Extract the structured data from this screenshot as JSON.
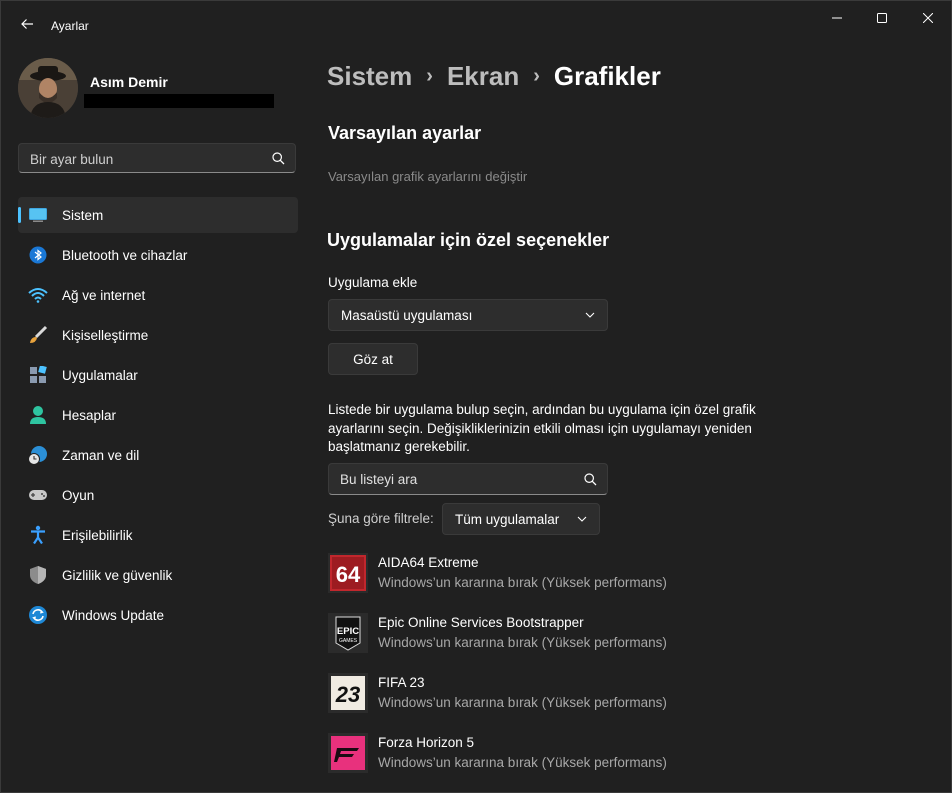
{
  "window": {
    "title": "Ayarlar"
  },
  "profile": {
    "name": "Asım Demir"
  },
  "search": {
    "placeholder": "Bir ayar bulun"
  },
  "nav": [
    {
      "label": "Sistem",
      "icon": "monitor-icon",
      "active": true
    },
    {
      "label": "Bluetooth ve cihazlar",
      "icon": "bluetooth-icon"
    },
    {
      "label": "Ağ ve internet",
      "icon": "wifi-icon"
    },
    {
      "label": "Kişiselleştirme",
      "icon": "brush-icon"
    },
    {
      "label": "Uygulamalar",
      "icon": "apps-icon"
    },
    {
      "label": "Hesaplar",
      "icon": "account-icon"
    },
    {
      "label": "Zaman ve dil",
      "icon": "globe-clock-icon"
    },
    {
      "label": "Oyun",
      "icon": "gamepad-icon"
    },
    {
      "label": "Erişilebilirlik",
      "icon": "accessibility-icon"
    },
    {
      "label": "Gizlilik ve güvenlik",
      "icon": "shield-icon"
    },
    {
      "label": "Windows Update",
      "icon": "windows-update-icon"
    }
  ],
  "breadcrumb": [
    "Sistem",
    "Ekran",
    "Grafikler"
  ],
  "defaults": {
    "heading": "Varsayılan ayarlar",
    "link": "Varsayılan grafik ayarlarını değiştir"
  },
  "custom": {
    "heading": "Uygulamalar için özel seçenekler",
    "add_label": "Uygulama ekle",
    "app_type": "Masaüstü uygulaması",
    "browse": "Göz at",
    "description": "Listede bir uygulama bulup seçin, ardından bu uygulama için özel grafik ayarlarını seçin. Değişikliklerinizin etkili olması için uygulamayı yeniden başlatmanız gerekebilir.",
    "list_search_placeholder": "Bu listeyi ara",
    "filter_label": "Şuna göre filtrele:",
    "filter_value": "Tüm uygulamalar"
  },
  "apps": [
    {
      "name": "AIDA64 Extreme",
      "pref": "Windows’un kararına bırak (Yüksek performans)",
      "icon_text": "64"
    },
    {
      "name": "Epic Online Services Bootstrapper",
      "pref": "Windows’un kararına bırak (Yüksek performans)",
      "icon_text": "EPIC"
    },
    {
      "name": "FIFA 23",
      "pref": "Windows’un kararına bırak (Yüksek performans)",
      "icon_text": "23"
    },
    {
      "name": "Forza Horizon 5",
      "pref": "Windows’un kararına bırak (Yüksek performans)",
      "icon_text": ""
    }
  ],
  "colors": {
    "accent": "#4cc2ff",
    "background": "#202020",
    "card": "#2d2d2d"
  }
}
